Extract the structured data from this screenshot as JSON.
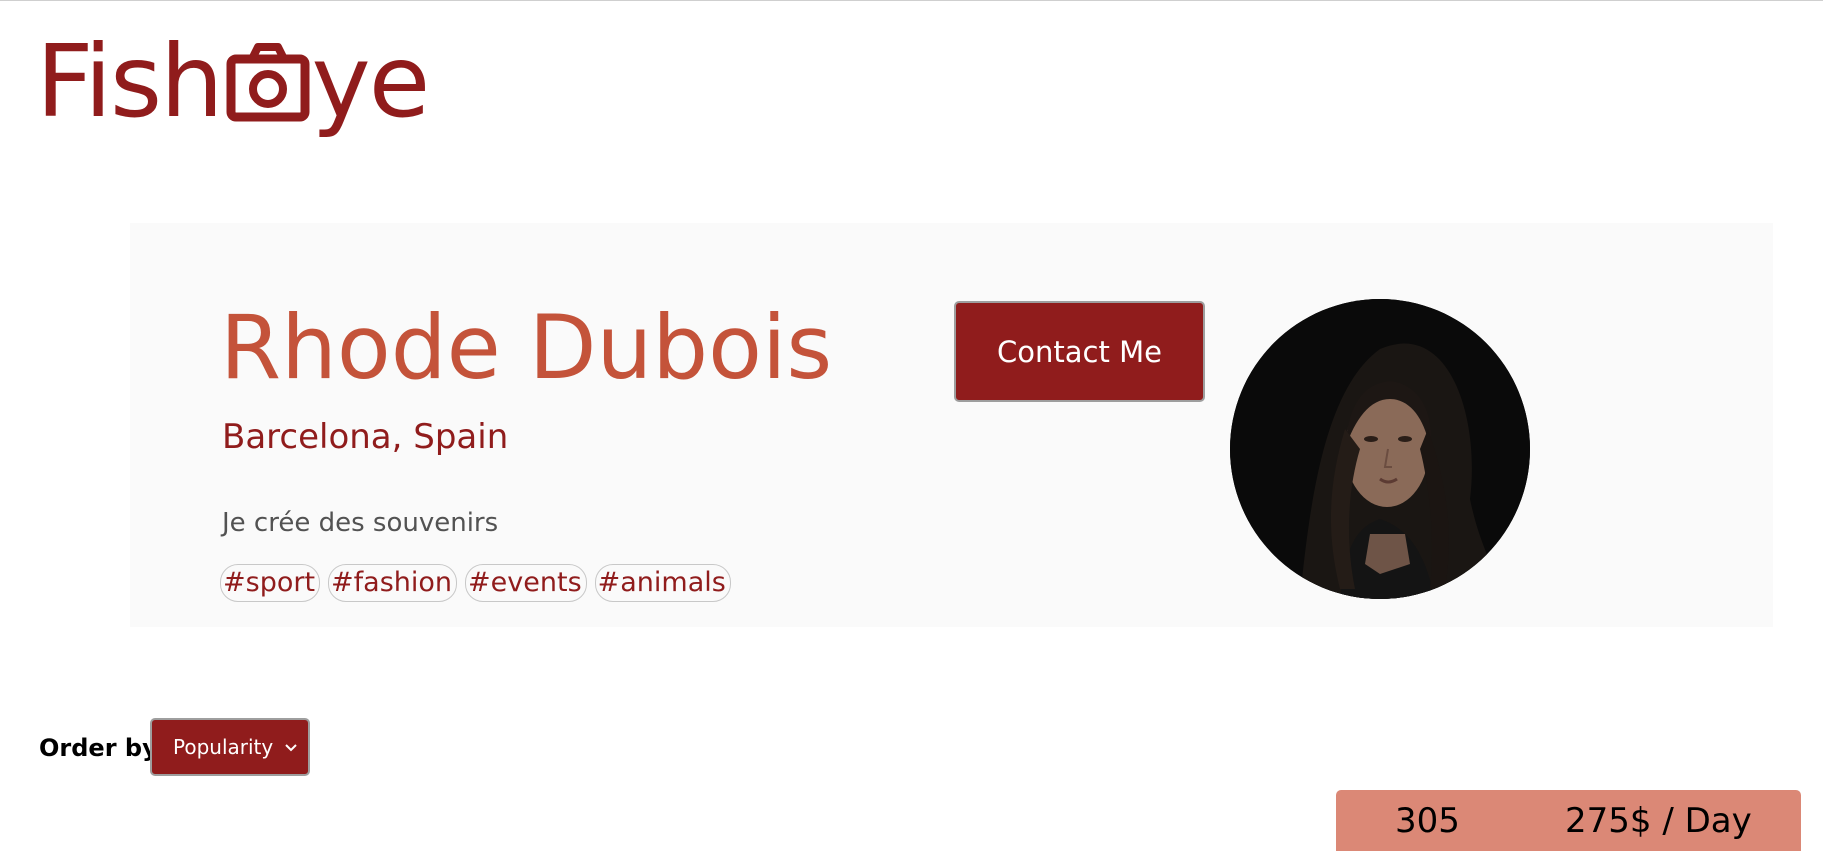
{
  "logo": {
    "text_before": "Fish",
    "text_after": "ye",
    "icon": "camera-icon",
    "color": "#901c1c"
  },
  "photographer": {
    "name": "Rhode Dubois",
    "location": "Barcelona, Spain",
    "tagline": "Je crée des souvenirs",
    "tags": [
      "#sport",
      "#fashion",
      "#events",
      "#animals"
    ],
    "portrait_icon": "portrait-photo"
  },
  "contact": {
    "label": "Contact Me"
  },
  "sort": {
    "label": "Order by",
    "selected": "Popularity",
    "icon": "chevron-down-icon"
  },
  "stats": {
    "likes": "305",
    "price": "275$ / Day"
  },
  "colors": {
    "brand": "#901c1c",
    "name": "#c4533a",
    "stats_bar": "#db8876",
    "card_bg": "#fafafa"
  }
}
